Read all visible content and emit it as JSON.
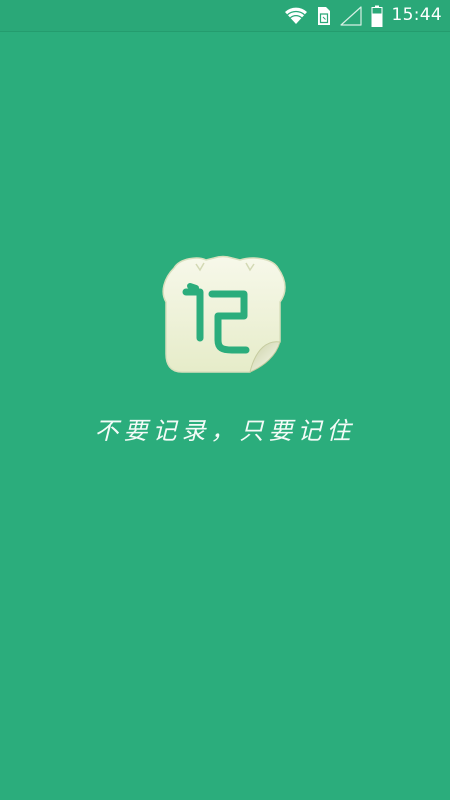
{
  "status_bar": {
    "time": "15:44",
    "icons": [
      "wifi-icon",
      "sim-card-icon",
      "cellular-signal-icon",
      "battery-icon"
    ]
  },
  "splash": {
    "logo_icon": "note-ji-logo-icon",
    "logo_text": "记",
    "slogan": "不要记录，只要记住"
  },
  "colors": {
    "background": "#2bad7c",
    "status_bar": "#2aa878",
    "logo_cream": "#f2f5df",
    "logo_glyph": "#2bad7c",
    "slogan_text": "#f3fbf7"
  }
}
